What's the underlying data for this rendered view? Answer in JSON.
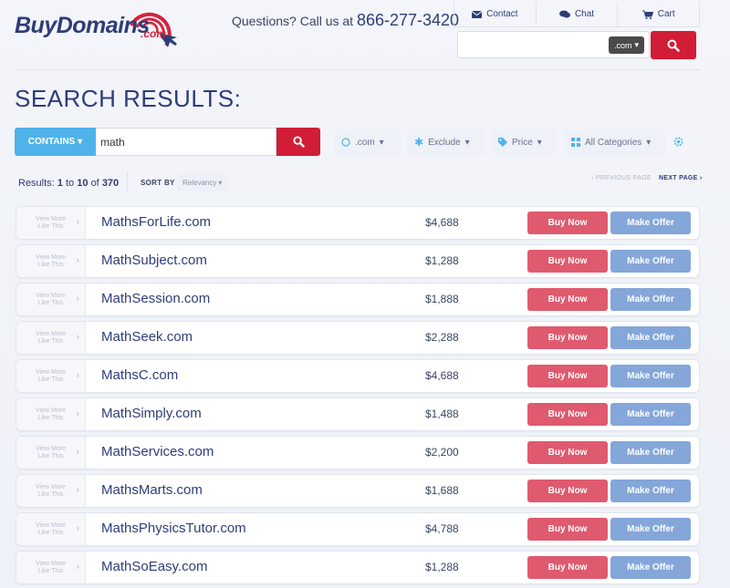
{
  "header": {
    "logo_text": "BuyDomains",
    "logo_suffix": ".com",
    "phone_prefix": "Questions? Call us at",
    "phone_number": "866-277-3420",
    "nav": [
      {
        "label": "Contact",
        "icon": "envelope-icon"
      },
      {
        "label": "Chat",
        "icon": "chat-icon"
      },
      {
        "label": "Cart",
        "icon": "cart-icon"
      }
    ],
    "search_value": "",
    "tld_option": ".com"
  },
  "page_title": "SEARCH RESULTS:",
  "search": {
    "mode": "CONTAINS",
    "query": "math",
    "filters": [
      {
        "label": ".com",
        "icon": "circle-icon"
      },
      {
        "label": "Exclude",
        "icon": "asterisk-icon"
      },
      {
        "label": "Price",
        "icon": "tag-icon"
      },
      {
        "label": "All Categories",
        "icon": "grid-icon"
      }
    ]
  },
  "results_meta": {
    "prefix": "Results:",
    "from": "1",
    "to_word": "to",
    "to": "10",
    "of_word": "of",
    "total": "370",
    "sort_label": "SORT BY",
    "sort_value": "Relevancy",
    "prev_label": "‹ PREVIOUS PAGE",
    "next_label": "NEXT PAGE ›"
  },
  "row_labels": {
    "view_more": "View More Like This",
    "buy": "Buy Now",
    "offer": "Make Offer"
  },
  "results": [
    {
      "domain": "MathsForLife.com",
      "price": "$4,688"
    },
    {
      "domain": "MathSubject.com",
      "price": "$1,288"
    },
    {
      "domain": "MathSession.com",
      "price": "$1,888"
    },
    {
      "domain": "MathSeek.com",
      "price": "$2,288"
    },
    {
      "domain": "MathsC.com",
      "price": "$4,688"
    },
    {
      "domain": "MathSimply.com",
      "price": "$1,488"
    },
    {
      "domain": "MathServices.com",
      "price": "$2,200"
    },
    {
      "domain": "MathsMarts.com",
      "price": "$1,688"
    },
    {
      "domain": "MathsPhysicsTutor.com",
      "price": "$4,788"
    },
    {
      "domain": "MathSoEasy.com",
      "price": "$1,288"
    }
  ],
  "colors": {
    "brand_navy": "#2e3d78",
    "brand_red": "#d11d36",
    "buy_button": "#df5a6f",
    "offer_button": "#84a6d9",
    "contains_blue": "#4fb3ea"
  }
}
